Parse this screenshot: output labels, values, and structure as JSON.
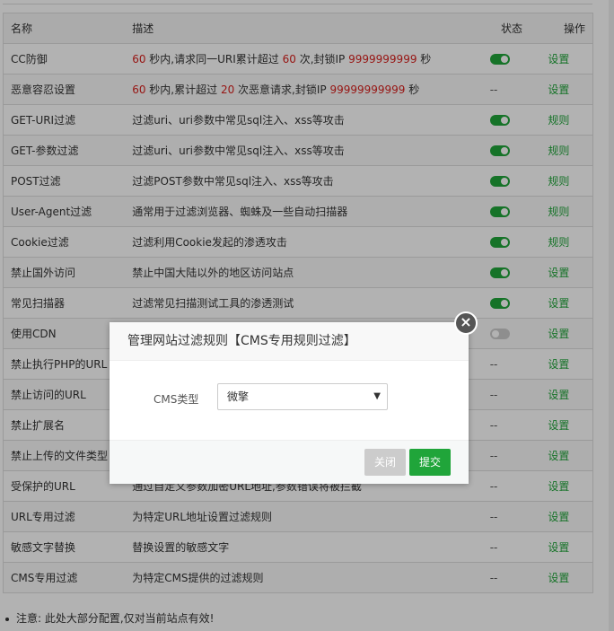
{
  "table": {
    "headers": {
      "name": "名称",
      "desc": "描述",
      "status": "状态",
      "op": "操作"
    },
    "rows": [
      {
        "name": "CC防御",
        "desc_parts": [
          {
            "t": "60",
            "red": true
          },
          {
            "t": " 秒内,请求同一URI累计超过 "
          },
          {
            "t": "60",
            "red": true
          },
          {
            "t": " 次,封锁IP "
          },
          {
            "t": "9999999999",
            "red": true
          },
          {
            "t": " 秒"
          }
        ],
        "status": "on",
        "op": "设置"
      },
      {
        "name": "恶意容忍设置",
        "desc_parts": [
          {
            "t": "60",
            "red": true
          },
          {
            "t": " 秒内,累计超过 "
          },
          {
            "t": "20",
            "red": true
          },
          {
            "t": " 次恶意请求,封锁IP "
          },
          {
            "t": "99999999999",
            "red": true
          },
          {
            "t": " 秒"
          }
        ],
        "status": "--",
        "op": "设置"
      },
      {
        "name": "GET-URI过滤",
        "desc": "过滤uri、uri参数中常见sql注入、xss等攻击",
        "status": "on",
        "op": "规则"
      },
      {
        "name": "GET-参数过滤",
        "desc": "过滤uri、uri参数中常见sql注入、xss等攻击",
        "status": "on",
        "op": "规则"
      },
      {
        "name": "POST过滤",
        "desc": "过滤POST参数中常见sql注入、xss等攻击",
        "status": "on",
        "op": "规则"
      },
      {
        "name": "User-Agent过滤",
        "desc": "通常用于过滤浏览器、蜘蛛及一些自动扫描器",
        "status": "on",
        "op": "规则"
      },
      {
        "name": "Cookie过滤",
        "desc": "过滤利用Cookie发起的渗透攻击",
        "status": "on",
        "op": "规则"
      },
      {
        "name": "禁止国外访问",
        "desc": "禁止中国大陆以外的地区访问站点",
        "status": "on",
        "op": "设置"
      },
      {
        "name": "常见扫描器",
        "desc": "过滤常见扫描测试工具的渗透测试",
        "status": "on",
        "op": "设置"
      },
      {
        "name": "使用CDN",
        "desc": "",
        "status": "off",
        "op": "设置"
      },
      {
        "name": "禁止执行PHP的URL",
        "desc": "",
        "status": "--",
        "op": "设置"
      },
      {
        "name": "禁止访问的URL",
        "desc": "",
        "status": "--",
        "op": "设置"
      },
      {
        "name": "禁止扩展名",
        "desc": "",
        "status": "--",
        "op": "设置"
      },
      {
        "name": "禁止上传的文件类型",
        "desc": "",
        "status": "--",
        "op": "设置"
      },
      {
        "name": "受保护的URL",
        "desc": "通过自定义参数加密URL地址,参数错误将被拦截",
        "status": "--",
        "op": "设置"
      },
      {
        "name": "URL专用过滤",
        "desc": "为特定URL地址设置过滤规则",
        "status": "--",
        "op": "设置"
      },
      {
        "name": "敏感文字替换",
        "desc": "替换设置的敏感文字",
        "status": "--",
        "op": "设置"
      },
      {
        "name": "CMS专用过滤",
        "desc": "为特定CMS提供的过滤规则",
        "status": "--",
        "op": "设置"
      }
    ]
  },
  "note": "注意: 此处大部分配置,仅对当前站点有效!",
  "modal": {
    "title": "管理网站过滤规则【CMS专用规则过滤】",
    "cms_label": "CMS类型",
    "cms_value": "微擎",
    "close_button": "关闭",
    "submit_button": "提交",
    "close_icon_glyph": "×"
  },
  "colors": {
    "accent": "#20a53a",
    "red": "#d9201d",
    "toggle_off": "#cccccc"
  }
}
